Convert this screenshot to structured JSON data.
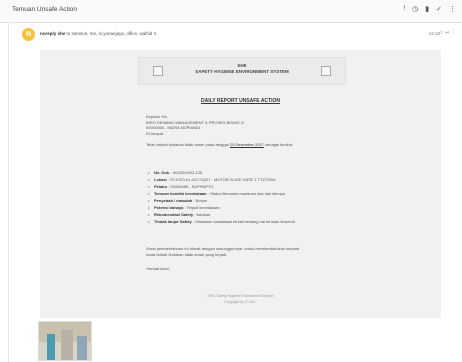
{
  "subject": "Temuan Unsafe Action",
  "toolbar_icons": [
    {
      "name": "important-icon",
      "glyph": "!"
    },
    {
      "name": "clock-icon",
      "glyph": "◷"
    },
    {
      "name": "trash-icon",
      "glyph": "▮"
    },
    {
      "name": "check-icon",
      "glyph": "✓"
    },
    {
      "name": "more-icon",
      "glyph": "⋮"
    }
  ],
  "message": {
    "avatar_letter": "N",
    "avatar_color": "#f3c340",
    "sender_name": "noreply she",
    "sender_rest": "to samsuri, me, ni.yonanjaya, office, walhid  ∨",
    "time": "13:18",
    "icons": "☆ ↩ ⋮"
  },
  "email": {
    "banner_line1": "SHE",
    "banner_line2": "SAFETY HYGIENE ENVIRONMENT SYSTEM",
    "report_title": "DAILY REPORT UNSAFE ACTION",
    "greeting": [
      "Kepada Yth.",
      "BIRO DEMAND MANAGEMENT & PROSES BISNIS G",
      "00000066 - INDRA NOPIANDI",
      "Di tempat"
    ],
    "intro_prefix": "Telah terjadi tindakan tidak aman pada tanggal",
    "intro_date": "20 Desember 2017",
    "intro_suffix": "sebagai berikut:",
    "items": [
      {
        "label": "No. Dok",
        "value": ": IN/2000/002-128"
      },
      {
        "label": "Lokasi",
        "value": ": ST-KSO-KL-017-SQ27 - MOTOR SLIDE GATE 1 TTZ7SW1"
      },
      {
        "label": "Pelaku",
        "value": ": 00000086 - SUPRAPTO"
      },
      {
        "label": "Temuan kondisi kecelakaan",
        "value": ": Status Bersama mantinan dan lain lainnya"
      },
      {
        "label": "Penyebab / masalah",
        "value": ": Bosan"
      },
      {
        "label": "Potensi bahaya",
        "value": ": Terjadi kecelakaan"
      },
      {
        "label": "Rekomendasi Safety",
        "value": ": lakukan"
      },
      {
        "label": "Tindak lanjut Safety",
        "value": ": Dilakukan sosialisasi terkait tentang hal temuan tersebut"
      }
    ],
    "closing": [
      "Surat pemberitahuan ini dibuat dengan sesungguhnya, untuk membentahukan kepada",
      "Anda terkait tindakan tidak aman yang terjadi."
    ],
    "signoff": "Hormat kami,",
    "footer1": "SHE, Safety Hygiene Environment System",
    "footer2": "Copyright by IT 2017"
  }
}
